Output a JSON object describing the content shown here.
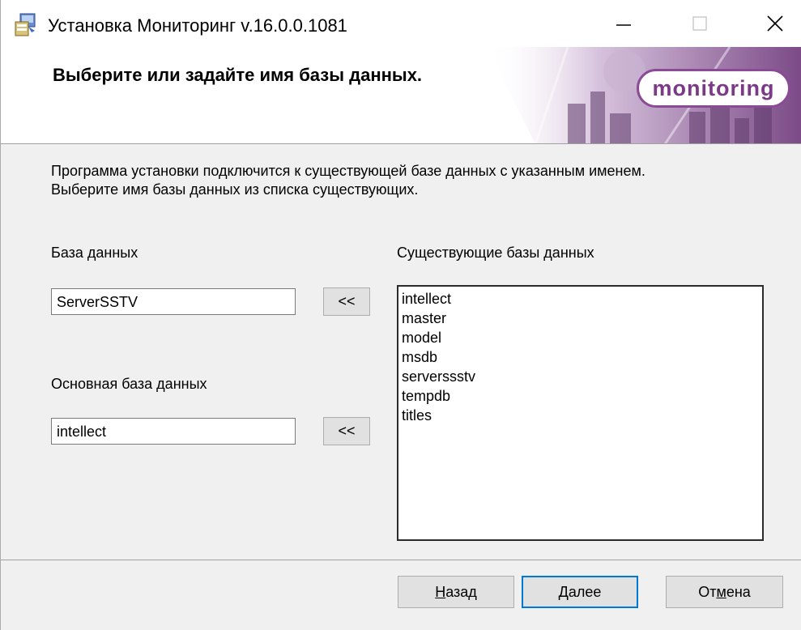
{
  "window": {
    "title": "Установка Мониторинг v.16.0.0.1081"
  },
  "banner": {
    "heading": "Выберите или задайте имя базы данных.",
    "logo_text": "monitoring"
  },
  "description": {
    "line1": "Программа установки подключится к существующей базе данных с указанным именем.",
    "line2": "Выберите имя базы данных из списка существующих."
  },
  "database": {
    "label": "База данных",
    "value": "ServerSSTV",
    "copy_button": "<<"
  },
  "main_database": {
    "label": "Основная база данных",
    "value": "intellect",
    "copy_button": "<<"
  },
  "existing": {
    "label": "Существующие базы данных",
    "items": [
      "intellect",
      "master",
      "model",
      "msdb",
      "serverssstv",
      "tempdb",
      "titles"
    ]
  },
  "footer": {
    "back": {
      "pre": "",
      "key": "Н",
      "post": "азад"
    },
    "next": {
      "pre": "",
      "key": "Д",
      "post": "алее"
    },
    "cancel": {
      "pre": "От",
      "key": "м",
      "post": "ена"
    }
  },
  "colors": {
    "logo": "#7a3a86",
    "accent": "#0078d7"
  },
  "icons": {
    "app": "installer-icon",
    "minimize": "minimize-icon",
    "maximize": "maximize-icon",
    "close": "close-icon"
  }
}
